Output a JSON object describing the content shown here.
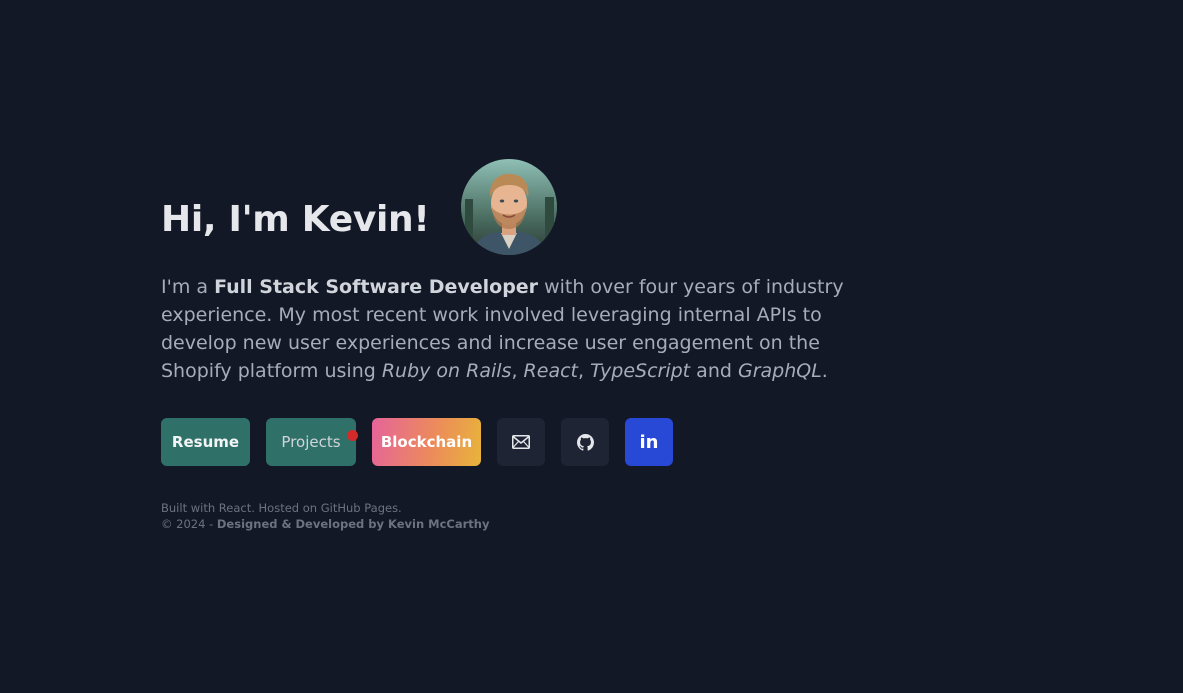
{
  "hero": {
    "greeting": "Hi, I'm Kevin!",
    "avatar_alt": "Kevin McCarthy portrait"
  },
  "intro": {
    "part1": "I'm a ",
    "role": "Full Stack Software Developer",
    "part2": " with over four years of industry experience. My most recent work involved leveraging internal APIs to develop new user experiences and increase user engagement on the Shopify platform using ",
    "tech1": "Ruby on Rails",
    "sep1": ", ",
    "tech2": "React",
    "sep2": ", ",
    "tech3": "TypeScript",
    "sep3": " and ",
    "tech4": "GraphQL",
    "end": "."
  },
  "buttons": {
    "resume": "Resume",
    "projects": "Projects",
    "blockchain": "Blockchain",
    "email_icon": "mail-icon",
    "github_icon": "github-icon",
    "linkedin_icon": "linkedin-icon",
    "linkedin_label": "in"
  },
  "footer": {
    "line1": "Built with React. Hosted on GitHub Pages.",
    "copyright": "© 2024 - ",
    "credit": "Designed & Developed by Kevin McCarthy"
  },
  "colors": {
    "background": "#121826",
    "teal": "#2f7168",
    "linkedin": "#2849d6",
    "notification_dot": "#d42a2a"
  }
}
